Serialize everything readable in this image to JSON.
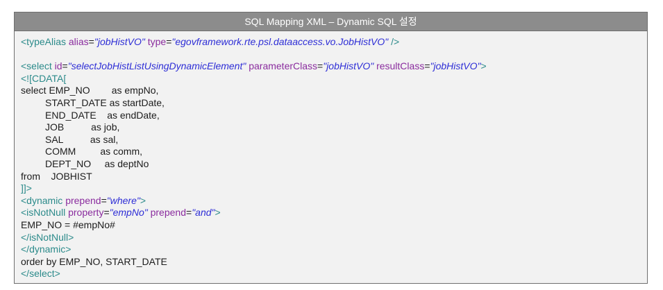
{
  "box": {
    "title": "SQL Mapping XML – Dynamic SQL 설정"
  },
  "colors": {
    "header_bg": "#8c8c8c",
    "header_text": "#ffffff",
    "body_bg": "#f2f2f2",
    "border": "#6e6e6e",
    "xml_tag": "#2b8a8a",
    "xml_attribute": "#8a2c9e",
    "xml_value": "#2d2dd6",
    "text": "#1c1c1c"
  },
  "code": {
    "lines": [
      [
        {
          "tag": "<typeAlias"
        },
        {
          "attr": " alias"
        },
        {
          "t": "="
        },
        {
          "val": "\"jobHistVO\""
        },
        {
          "attr": " type"
        },
        {
          "t": "="
        },
        {
          "val": "\"egovframework.rte.psl.dataaccess.vo.JobHistVO\""
        },
        {
          "tag": " />"
        }
      ],
      [],
      [
        {
          "tag": "<select"
        },
        {
          "attr": " id"
        },
        {
          "t": "="
        },
        {
          "val": "\"selectJobHistListUsingDynamicElement\""
        },
        {
          "attr": " parameterClass"
        },
        {
          "t": "="
        },
        {
          "val": "\"jobHistVO\""
        },
        {
          "attr": " resultClass"
        },
        {
          "t": "="
        },
        {
          "val": "\"jobHistVO\""
        },
        {
          "tag": ">"
        }
      ],
      [
        {
          "tag": "<![CDATA["
        }
      ],
      [
        {
          "t": "select EMP_NO        as empNo,"
        }
      ],
      [
        {
          "t": "         START_DATE as startDate,"
        }
      ],
      [
        {
          "t": "         END_DATE    as endDate,"
        }
      ],
      [
        {
          "t": "         JOB          as job,"
        }
      ],
      [
        {
          "t": "         SAL          as sal,"
        }
      ],
      [
        {
          "t": "         COMM         as comm,"
        }
      ],
      [
        {
          "t": "         DEPT_NO     as deptNo"
        }
      ],
      [
        {
          "t": "from    JOBHIST"
        }
      ],
      [
        {
          "tag": "]]>"
        }
      ],
      [
        {
          "tag": "<dynamic"
        },
        {
          "attr": " prepend"
        },
        {
          "t": "="
        },
        {
          "val": "\"where\""
        },
        {
          "tag": ">"
        }
      ],
      [
        {
          "tag": "<isNotNull"
        },
        {
          "attr": " property"
        },
        {
          "t": "="
        },
        {
          "val": "\"empNo\""
        },
        {
          "attr": " prepend"
        },
        {
          "t": "="
        },
        {
          "val": "\"and\""
        },
        {
          "tag": ">"
        }
      ],
      [
        {
          "t": "EMP_NO = #empNo#"
        }
      ],
      [
        {
          "tag": "</isNotNull>"
        }
      ],
      [
        {
          "tag": "</dynamic>"
        }
      ],
      [
        {
          "t": "order by EMP_NO, START_DATE"
        }
      ],
      [
        {
          "tag": "</select>"
        }
      ]
    ]
  }
}
